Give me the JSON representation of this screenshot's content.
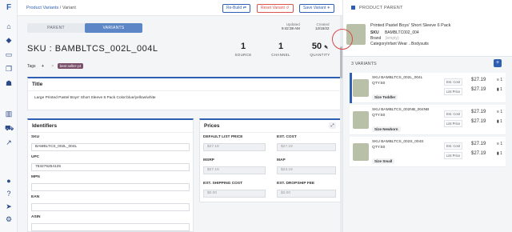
{
  "breadcrumb": {
    "parent": "Product Variants",
    "sep": " / ",
    "current": "Variant"
  },
  "actions": {
    "rebuild": "Re-Build ⇄",
    "reset": "Reset Variant ↺",
    "save": "Save Variant ✈"
  },
  "tabs": {
    "parent": "PARENT",
    "variants": "VARIANTS"
  },
  "sku_title": "SKU : BAMBLTCS_002L_004L",
  "stats": {
    "source": {
      "value": "1",
      "label": "SOURCE"
    },
    "channel": {
      "value": "1",
      "label": "CHANNEL"
    },
    "quantity": {
      "value": "50",
      "label": "QUANTITY"
    }
  },
  "dates": {
    "updated_label": "Updated",
    "updated_value": "9:42:38 AM",
    "created_label": "Created",
    "created_value": "12/15/22"
  },
  "tags": {
    "label": "Tags",
    "add": "+",
    "remove": "×",
    "tag": "best seller-y4"
  },
  "title_card": {
    "heading": "Title",
    "value": "Large Printed Pastel Boys' Short Sleeve 6 Pack Color:blue/yellow/white"
  },
  "identifiers": {
    "heading": "Identifiers",
    "sku_label": "SKU",
    "sku_value": "BAMBLTCS_002L_004L",
    "upc_label": "UPC",
    "upc_value": "763276254125",
    "mpn_label": "MPN",
    "mpn_value": "",
    "ean_label": "EAN",
    "ean_value": "",
    "asin_label": "ASIN",
    "asin_value": ""
  },
  "prices": {
    "heading": "Prices",
    "default_list_label": "DEFAULT LIST PRICE",
    "default_list_value": "$27.19",
    "est_cost_label": "EST. COST",
    "est_cost_value": "$27.19",
    "msrp_label": "MSRP",
    "msrp_value": "$27.19",
    "map_label": "MAP",
    "map_value": "$23.19",
    "shipping_label": "EST. SHIPPING COST",
    "shipping_value": "$0.00",
    "dropship_label": "EST. DROPSHIP FEE",
    "dropship_value": "$2.00"
  },
  "product_parent": {
    "heading": "PRODUCT PARENT",
    "title": "Printed Pastel Boys' Short Sleeve 6 Pack",
    "sku_label": "SKU",
    "sku_value": "BAMBLTC002_004",
    "brand_label": "Brand",
    "brand_value": "(empty)",
    "category_label": "Category",
    "category_value": "Infant Wear→Bodysuits"
  },
  "variants_header": {
    "count_label": "3 VARIANTS",
    "add": "+"
  },
  "variants": [
    {
      "sku": "SKU BAMBLTCS_002L_004L",
      "qty": "QTY:50",
      "size": "Size Toddler",
      "cost_label": "Est. Cost",
      "cost": "$27.19",
      "list_label": "List Price",
      "list": "$27.19",
      "qty_badge": "1"
    },
    {
      "sku": "SKU BAMBLTCS_002NB_004NB",
      "qty": "QTY:50",
      "size": "Size Newborn",
      "cost_label": "Est. Cost",
      "cost": "$27.19",
      "list_label": "List Price",
      "list": "$27.19",
      "qty_badge": "1"
    },
    {
      "sku": "SKU BAMBLTCS_002S_004S",
      "qty": "QTY:50",
      "size": "Size Small",
      "cost_label": "Est. Cost",
      "cost": "$27.19",
      "list_label": "List Price",
      "list": "$27.19",
      "qty_badge": "1"
    }
  ],
  "colors": {
    "accent": "#2f5fb3",
    "tab_active": "#5d86c6",
    "save": "#2f5fb3",
    "reset": "#d9534f",
    "tag": "#7a4f6a"
  }
}
